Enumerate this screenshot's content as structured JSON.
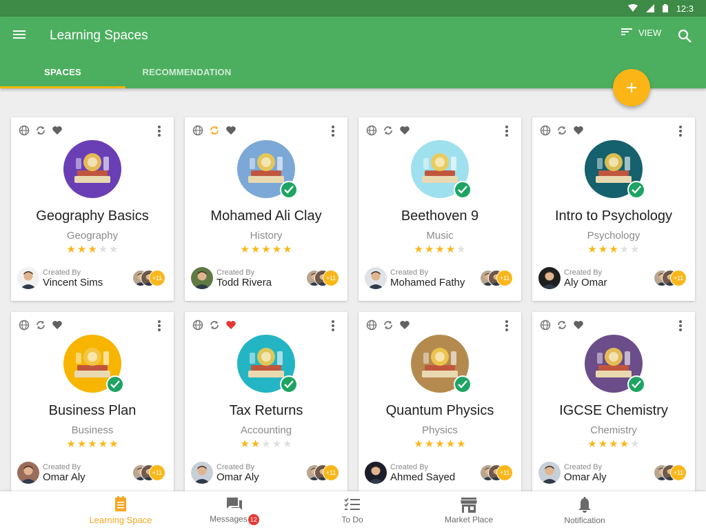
{
  "status_bar": {
    "time": "12:3"
  },
  "app_bar": {
    "title": "Learning Spaces",
    "view_label": "VIEW"
  },
  "tabs": [
    {
      "label": "SPACES",
      "active": true
    },
    {
      "label": "RECOMMENDATION",
      "active": false
    }
  ],
  "accent_colors": {
    "primary": "#4caf5f",
    "status_bar": "#3d8b46",
    "accent": "#fbb516",
    "check": "#1da462",
    "heart_active": "#e53935",
    "sync_active": "#f5a623"
  },
  "cards": [
    {
      "title": "Geography Basics",
      "category": "Geography",
      "rating": 3,
      "created_by_label": "Created By",
      "author": "Vincent Sims",
      "members_more": "+11",
      "checked": false,
      "favorite": false,
      "syncing": false,
      "image_icon": "globe-books-icon",
      "image_bg": "#6a3fb5"
    },
    {
      "title": "Mohamed Ali Clay",
      "category": "History",
      "rating": 5,
      "created_by_label": "Created By",
      "author": "Todd Rivera",
      "members_more": "+11",
      "checked": true,
      "favorite": false,
      "syncing": true,
      "image_icon": "column-globe-icon",
      "image_bg": "#7ba8d6"
    },
    {
      "title": "Beethoven 9",
      "category": "Music",
      "rating": 4,
      "created_by_label": "Created By",
      "author": "Mohamed Fathy",
      "members_more": "+11",
      "checked": true,
      "favorite": false,
      "syncing": false,
      "image_icon": "drummer-girl-icon",
      "image_bg": "#9fe0ef"
    },
    {
      "title": "Intro to Psychology",
      "category": "Psychology",
      "rating": 3,
      "created_by_label": "Created By",
      "author": "Aly Omar",
      "members_more": "+11",
      "checked": true,
      "favorite": false,
      "syncing": false,
      "image_icon": "head-profile-icon",
      "image_bg": "#15616d"
    },
    {
      "title": "Business Plan",
      "category": "Business",
      "rating": 5,
      "created_by_label": "Created By",
      "author": "Omar Aly",
      "members_more": "+11",
      "checked": true,
      "favorite": false,
      "syncing": false,
      "image_icon": "business-chart-icon",
      "image_bg": "#f7b500"
    },
    {
      "title": "Tax Returns",
      "category": "Accounting",
      "rating": 2,
      "created_by_label": "Created By",
      "author": "Omar Aly",
      "members_more": "+11",
      "checked": true,
      "favorite": true,
      "syncing": false,
      "image_icon": "calculator-keyboard-icon",
      "image_bg": "#23b5c4"
    },
    {
      "title": "Quantum Physics",
      "category": "Physics",
      "rating": 5,
      "created_by_label": "Created By",
      "author": "Ahmed Sayed",
      "members_more": "+11",
      "checked": true,
      "favorite": false,
      "syncing": false,
      "image_icon": "newton-cradle-icon",
      "image_bg": "#b58a4f"
    },
    {
      "title": "IGCSE Chemistry",
      "category": "Chemistry",
      "rating": 4,
      "created_by_label": "Created By",
      "author": "Omar Aly",
      "members_more": "+11",
      "checked": true,
      "favorite": false,
      "syncing": false,
      "image_icon": "lab-flasks-icon",
      "image_bg": "#6b4d8a"
    }
  ],
  "bottom_nav": [
    {
      "label": "Learning Space",
      "active": true,
      "icon": "learning-space-icon"
    },
    {
      "label": "Messages",
      "badge": "12",
      "active": false,
      "icon": "messages-icon"
    },
    {
      "label": "To Do",
      "active": false,
      "icon": "todo-list-icon"
    },
    {
      "label": "Market Place",
      "active": false,
      "icon": "store-icon"
    },
    {
      "label": "Notification",
      "active": false,
      "icon": "bell-icon"
    }
  ]
}
